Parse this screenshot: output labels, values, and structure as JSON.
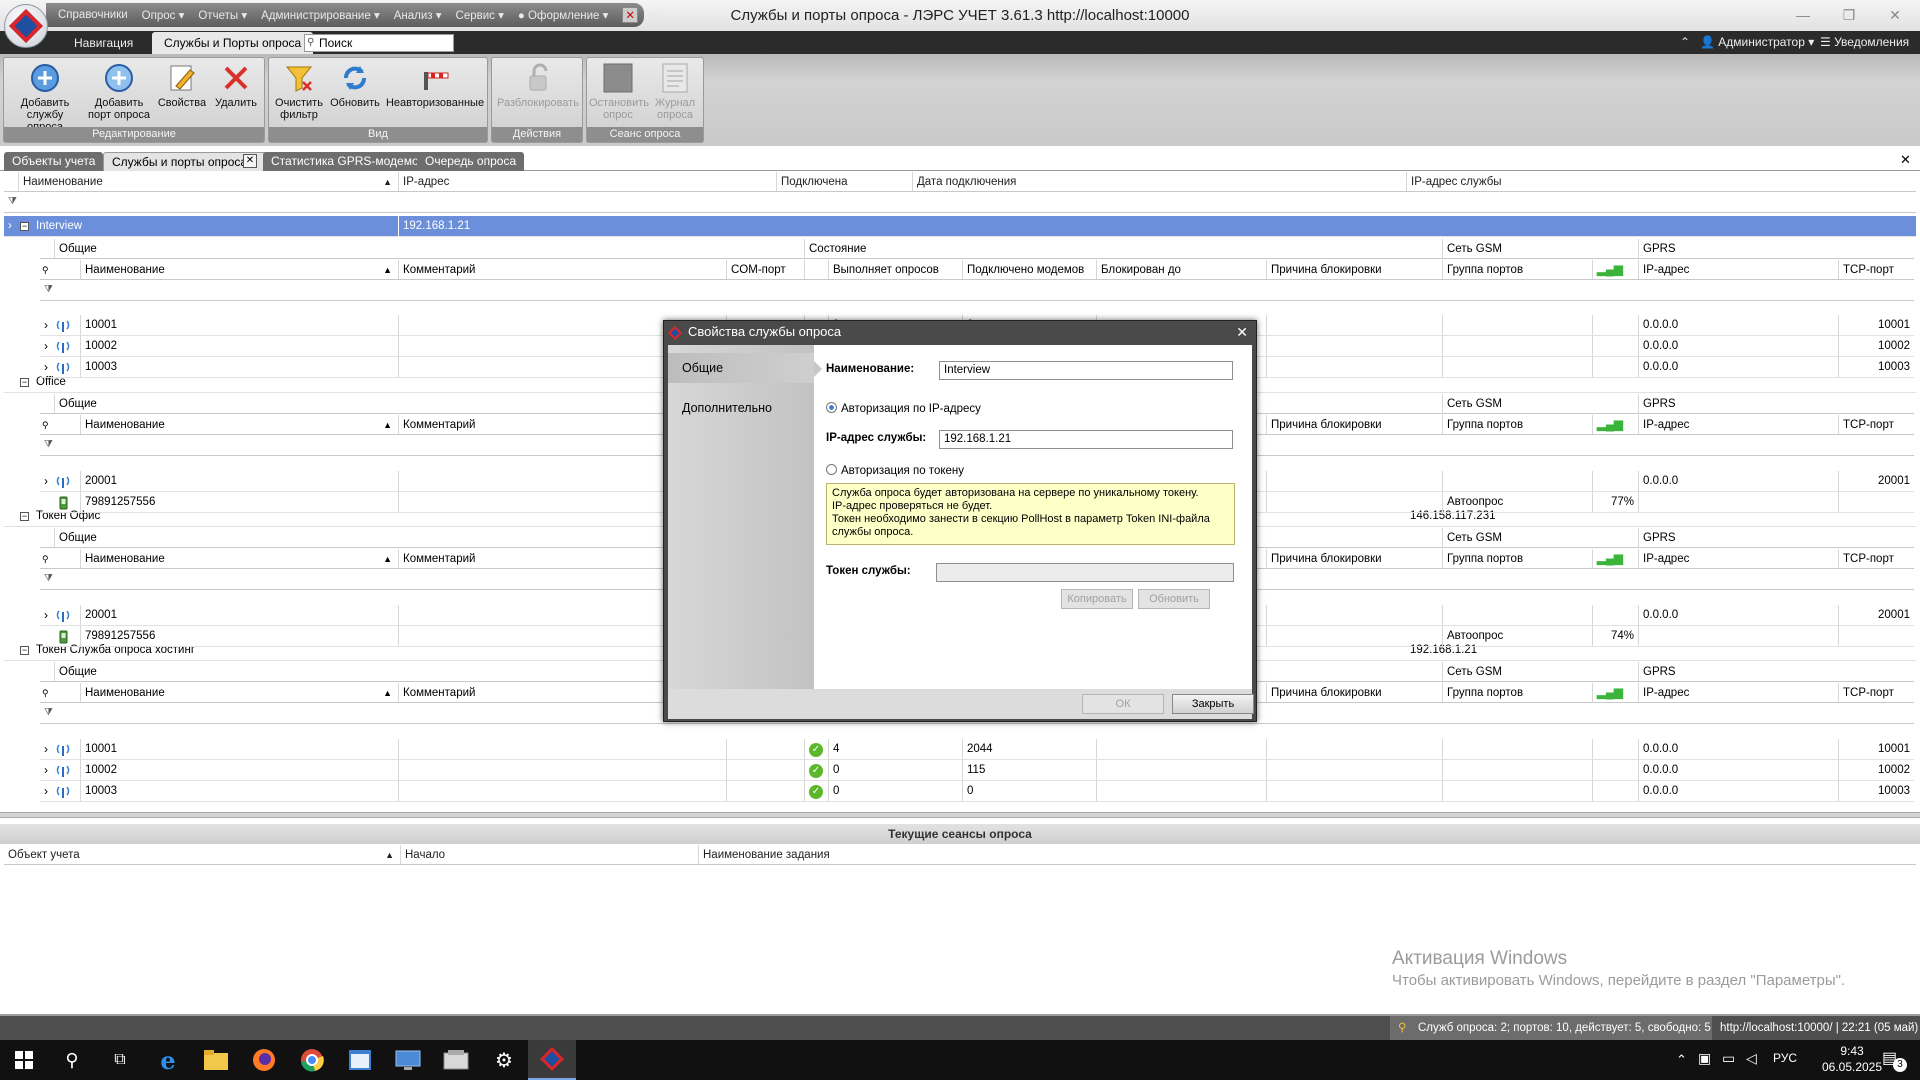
{
  "menu": [
    "Справочники",
    "Опрос",
    "Отчеты",
    "Администрирование",
    "Анализ",
    "Сервис",
    "Оформление"
  ],
  "window_title": "Службы и порты опроса - ЛЭРС УЧЕТ 3.61.3 http://localhost:10000",
  "ribbon_tabs": {
    "nav": "Навигация",
    "services": "Службы и Порты опроса"
  },
  "search_placeholder": "Поиск",
  "user": "Администратор",
  "notifications": "Уведомления",
  "ribbon": {
    "add_service": [
      "Добавить",
      "службу опроса"
    ],
    "add_port": [
      "Добавить",
      "порт опроса"
    ],
    "properties": "Свойства",
    "delete": "Удалить",
    "group_edit": "Редактирование",
    "clear_filter": [
      "Очистить",
      "фильтр"
    ],
    "refresh": "Обновить",
    "unauthorized": "Неавторизованные",
    "group_view": "Вид",
    "unblock": "Разблокировать",
    "group_actions": "Действия",
    "stop_poll": [
      "Остановить",
      "опрос"
    ],
    "poll_log": [
      "Журнал",
      "опроса"
    ],
    "group_session": "Сеанс опроса"
  },
  "doc_tabs": [
    "Объекты учета",
    "Службы и порты опроса",
    "Статистика GPRS-модемов",
    "Очередь опроса"
  ],
  "main_columns": [
    "Наименование",
    "IP-адрес",
    "Подключена",
    "Дата подключения",
    "IP-адрес службы"
  ],
  "sub_group_headers": {
    "general": "Общие",
    "state": "Состояние",
    "gsm": "Сеть GSM",
    "gprs": "GPRS"
  },
  "sub_columns": [
    "Наименование",
    "Комментарий",
    "COM-порт",
    "Выполняет опросов",
    "Подключено модемов",
    "Блокирован до",
    "Причина блокировки",
    "Группа портов",
    "IP-адрес",
    "TCP-порт"
  ],
  "groups": [
    {
      "name": "Interview",
      "ip": "192.168.1.21",
      "service_ip": "",
      "rows": [
        {
          "name": "10001",
          "polls": "0",
          "modems": "0",
          "ip": "0.0.0.0",
          "tcp": "10001",
          "group": "",
          "signal": ""
        },
        {
          "name": "10002",
          "polls": "",
          "modems": "",
          "ip": "0.0.0.0",
          "tcp": "10002",
          "group": "",
          "signal": ""
        },
        {
          "name": "10003",
          "polls": "",
          "modems": "",
          "ip": "0.0.0.0",
          "tcp": "10003",
          "group": "",
          "signal": ""
        }
      ]
    },
    {
      "name": "Office",
      "ip": "",
      "service_ip": "",
      "rows": [
        {
          "name": "20001",
          "polls": "",
          "modems": "",
          "ip": "0.0.0.0",
          "tcp": "20001",
          "group": "",
          "signal": ""
        },
        {
          "name": "79891257556",
          "polls": "",
          "modems": "",
          "ip": "",
          "tcp": "",
          "group": "Автоопрос",
          "signal": "77%"
        }
      ]
    },
    {
      "name": "Токен Офис",
      "ip": "",
      "service_ip": "146.158.117.231",
      "rows": [
        {
          "name": "20001",
          "polls": "",
          "modems": "",
          "ip": "0.0.0.0",
          "tcp": "20001",
          "group": "",
          "signal": ""
        },
        {
          "name": "79891257556",
          "polls": "",
          "modems": "",
          "ip": "",
          "tcp": "",
          "group": "Автоопрос",
          "signal": "74%"
        }
      ]
    },
    {
      "name": "Токен Служба опроса хостинг",
      "ip": "",
      "service_ip": "192.168.1.21",
      "rows": [
        {
          "name": "10001",
          "polls": "4",
          "modems": "2044",
          "ip": "0.0.0.0",
          "tcp": "10001",
          "group": "",
          "signal": ""
        },
        {
          "name": "10002",
          "polls": "0",
          "modems": "115",
          "ip": "0.0.0.0",
          "tcp": "10002",
          "group": "",
          "signal": ""
        },
        {
          "name": "10003",
          "polls": "0",
          "modems": "0",
          "ip": "0.0.0.0",
          "tcp": "10003",
          "group": "",
          "signal": ""
        }
      ]
    }
  ],
  "modal": {
    "title": "Свойства службы опроса",
    "tab_general": "Общие",
    "tab_additional": "Дополнительно",
    "name_label": "Наименование:",
    "name_value": "Interview",
    "radio_ip": "Авторизация по IP-адресу",
    "ip_label": "IP-адрес службы:",
    "ip_value": "192.168.1.21",
    "radio_token": "Авторизация по токену",
    "info_lines": [
      "Служба опроса будет авторизована на сервере по уникальному токену.",
      "IP-адрес проверяться не будет.",
      "Токен необходимо занести в секцию PollHost в параметр Token INI-файла",
      "службы опроса."
    ],
    "token_label": "Токен службы:",
    "copy": "Копировать",
    "refresh": "Обновить",
    "ok": "ОК",
    "close": "Закрыть"
  },
  "bottom": {
    "title": "Текущие сеансы опроса",
    "columns": [
      "Объект учета",
      "Начало",
      "Наименование задания"
    ]
  },
  "watermark": {
    "line1": "Активация Windows",
    "line2": "Чтобы активировать Windows, перейдите в раздел \"Параметры\"."
  },
  "status": {
    "summary": "Служб опроса: 2; портов: 10, действует: 5, свободно: 5",
    "server": "http://localhost:10000/ | 22:21 (05 май)"
  },
  "taskbar": {
    "lang": "РУС",
    "time": "9:43",
    "date": "06.05.2025",
    "notif_count": "3"
  },
  "colors": {
    "selection": "#6b8fdb",
    "ok_green": "#5cb82a",
    "info_bg": "#ffffc8"
  }
}
